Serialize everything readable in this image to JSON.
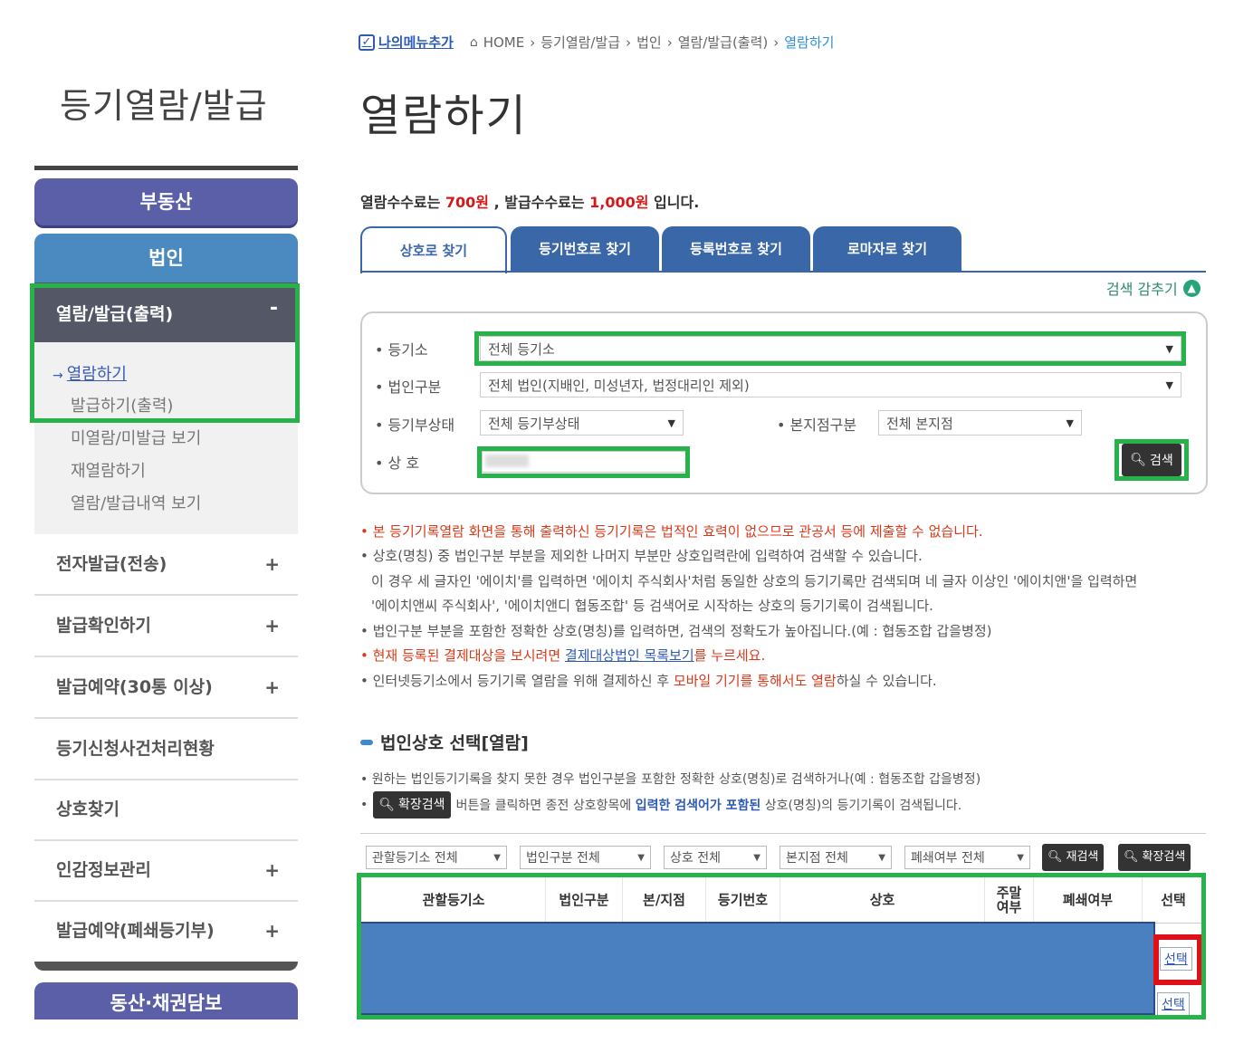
{
  "sidebar": {
    "title": "등기열람/발급",
    "realty_label": "부동산",
    "corp_label": "법인",
    "open_section": {
      "label": "열람/발급(출력)",
      "toggle": "-",
      "items": [
        "열람하기",
        "발급하기(출력)",
        "미열람/미발급 보기",
        "재열람하기",
        "열람/발급내역 보기"
      ]
    },
    "menus": [
      {
        "label": "전자발급(전송)",
        "toggle": "+"
      },
      {
        "label": "발급확인하기",
        "toggle": "+"
      },
      {
        "label": "발급예약(30통 이상)",
        "toggle": "+"
      },
      {
        "label": "등기신청사건처리현황",
        "toggle": ""
      },
      {
        "label": "상호찾기",
        "toggle": ""
      },
      {
        "label": "인감정보관리",
        "toggle": "+"
      },
      {
        "label": "발급예약(폐쇄등기부)",
        "toggle": "+"
      }
    ],
    "movable_label": "동산·채권담보"
  },
  "breadcrumb": {
    "my_menu": "나의메뉴추가",
    "items": [
      "HOME",
      "등기열람/발급",
      "법인",
      "열람/발급(출력)",
      "열람하기"
    ],
    "sep": "›"
  },
  "page_title": "열람하기",
  "fee": {
    "pre": "열람수수료는 ",
    "view_fee": "700원",
    "mid": " , 발급수수료는 ",
    "issue_fee": "1,000원",
    "post": " 입니다."
  },
  "tabs": [
    "상호로 찾기",
    "등기번호로 찾기",
    "등록번호로 찾기",
    "로마자로 찾기"
  ],
  "collapse_label": "검색 감추기",
  "form": {
    "registry_label": "• 등기소",
    "registry_value": "전체 등기소",
    "corp_type_label": "• 법인구분",
    "corp_type_value": "전체 법인(지배인, 미성년자, 법정대리인 제외)",
    "status_label": "• 등기부상태",
    "status_value": "전체 등기부상태",
    "branch_label": "• 본지점구분",
    "branch_value": "전체 본지점",
    "name_label": "• 상 호",
    "name_value": "",
    "search_button": "검색"
  },
  "notes": [
    "• 본 등기기록열람 화면을 통해 출력하신 등기기록은 법적인 효력이 없으므로 관공서 등에 제출할 수 없습니다.",
    "• 상호(명칭) 중 법인구분 부분을 제외한 나머지 부분만 상호입력란에 입력하여 검색할 수 있습니다.",
    "이 경우 세 글자인 '에이치'를 입력하면 '에이치 주식회사'처럼 동일한 상호의 등기기록만 검색되며 네 글자 이상인 '에이치앤'을 입력하면",
    "'에이치앤씨 주식회사', '에이치앤디 협동조합' 등 검색어로 시작하는 상호의 등기기록이 검색됩니다.",
    "• 법인구분 부분을 포함한 정확한 상호(명칭)를 입력하면, 검색의 정확도가 높아집니다.(예 : 협동조합 갑을병정)"
  ],
  "note_red": {
    "pre": "• 현재 등록된 결제대상을 보시려면 ",
    "link": "결제대상법인 목록보기",
    "post": "를 누르세요."
  },
  "note_last": {
    "pre": "• 인터넷등기소에서 등기기록 열람을 위해 결제하신 후 ",
    "red": "모바일 기기를 통해서도 열람",
    "post": "하실 수 있습니다."
  },
  "section": {
    "title": "법인상호 선택[열람]",
    "line1": "• 원하는 법인등기기록을 찾지 못한 경우 법인구분을 포함한 정확한 상호(명칭)로 검색하거나(예 : 협동조합 갑을병정)",
    "line2_btn": "확장검색",
    "line2_pre": " 버튼을 클릭하면 종전 상호항목에 ",
    "line2_blue": "입력한 검색어가 포함된",
    "line2_post": " 상호(명칭)의 등기기록이 검색됩니다."
  },
  "filters": [
    "관할등기소 전체",
    "법인구분 전체",
    "상호 전체",
    "본지점 전체",
    "폐쇄여부 전체"
  ],
  "filter_buttons": [
    "재검색",
    "확장검색"
  ],
  "table": {
    "headers": [
      "관할등기소",
      "법인구분",
      "본/지점",
      "등기번호",
      "상호",
      "주말\n여부",
      "폐쇄여부",
      "선택"
    ],
    "select_label": "선택"
  }
}
